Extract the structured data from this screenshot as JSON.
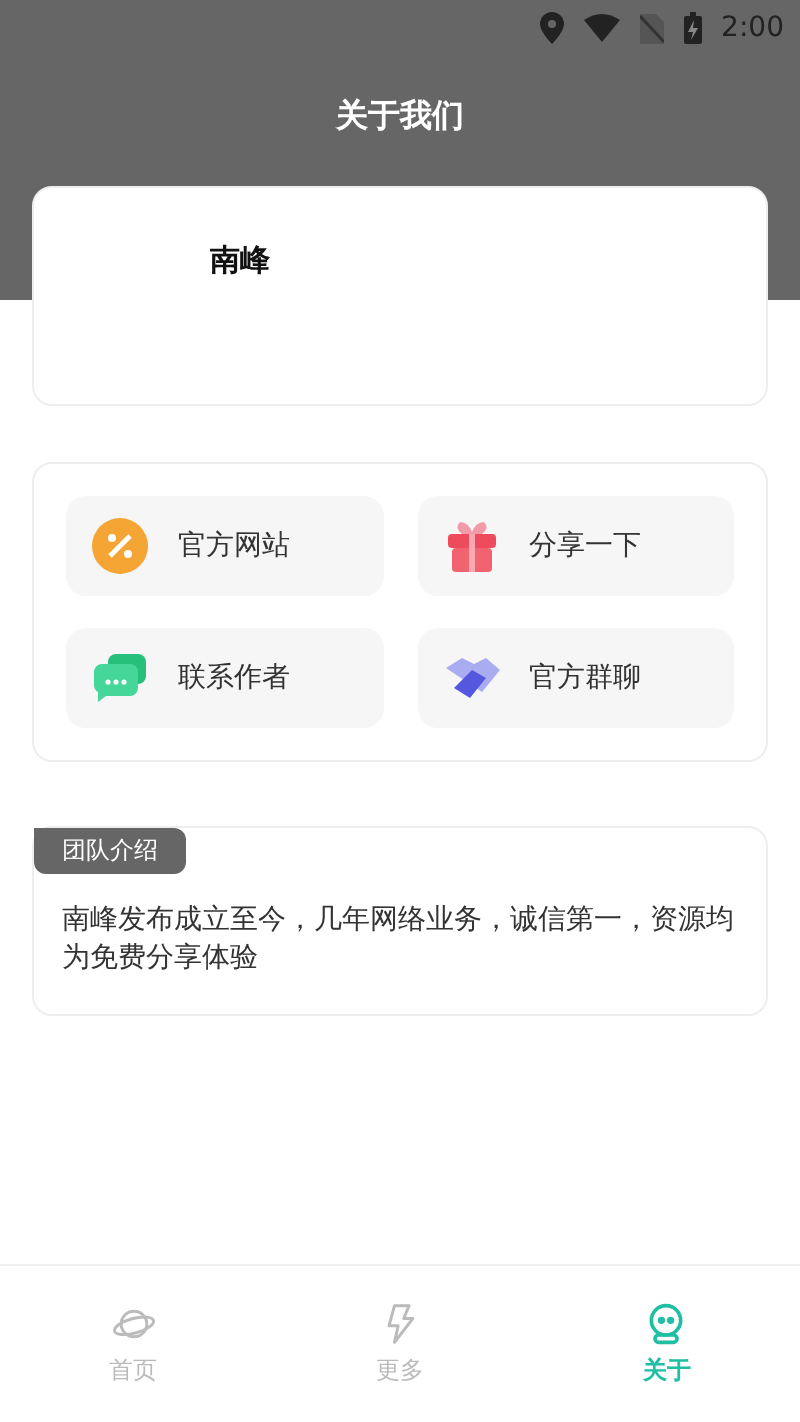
{
  "status_bar": {
    "time": "2:00"
  },
  "title": "关于我们",
  "profile": {
    "name": "南峰"
  },
  "links": [
    {
      "label": "官方网站"
    },
    {
      "label": "分享一下"
    },
    {
      "label": "联系作者"
    },
    {
      "label": "官方群聊"
    }
  ],
  "team": {
    "badge": "团队介绍",
    "text": "南峰发布成立至今，几年网络业务，诚信第一，资源均为免费分享体验"
  },
  "tabs": [
    {
      "label": "首页",
      "selected": false
    },
    {
      "label": "更多",
      "selected": false
    },
    {
      "label": "关于",
      "selected": true
    }
  ]
}
